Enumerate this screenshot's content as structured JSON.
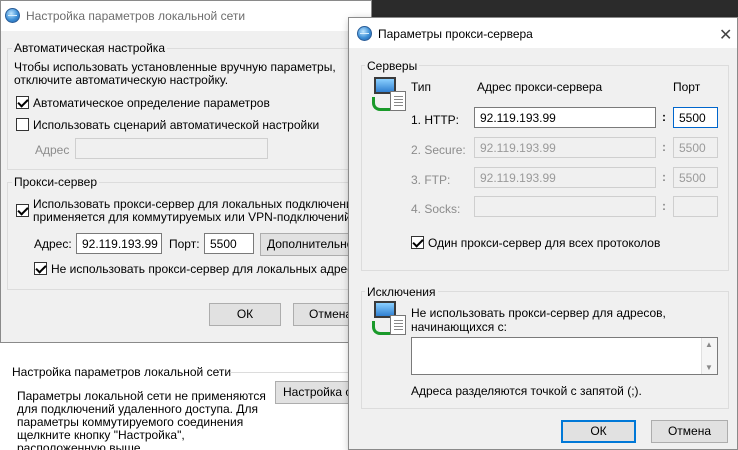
{
  "lan_window": {
    "title": "Настройка параметров локальной сети",
    "auto_group_label": "Автоматическая настройка",
    "auto_desc_1": "Чтобы использовать установленные вручную параметры,",
    "auto_desc_2": "отключите автоматическую настройку.",
    "auto_detect_label": "Автоматическое определение параметров",
    "auto_script_label": "Использовать сценарий автоматической настройки",
    "address_label": "Адрес",
    "proxy_group_label": "Прокси-сервер",
    "use_proxy_label_1": "Использовать прокси-сервер для локальных подключений (не",
    "use_proxy_label_2": "применяется для коммутируемых или VPN-подключений).",
    "proxy_address_label": "Адрес:",
    "proxy_address_value": "92.119.193.99",
    "port_label": "Порт:",
    "port_value": "5500",
    "advanced_button": "Дополнительно",
    "bypass_local_label": "Не использовать прокси-сервер для локальных адресов",
    "ok_button": "ОК",
    "cancel_button": "Отмена"
  },
  "background": {
    "section_title": "Настройка параметров локальной сети",
    "desc_lines": [
      "Параметры локальной сети не применяются",
      "для подключений удаленного доступа. Для",
      "параметры коммутируемого соединения",
      "щелкните кнопку \"Настройка\",",
      "расположенную выше."
    ],
    "settings_button": "Настройка се"
  },
  "proxy_window": {
    "title": "Параметры прокси-сервера",
    "close": "✕",
    "servers_group_label": "Серверы",
    "col_type": "Тип",
    "col_address": "Адрес прокси-сервера",
    "col_port": "Порт",
    "rows": [
      {
        "type": "1. HTTP:",
        "address": "92.119.193.99",
        "port": "5500"
      },
      {
        "type": "2. Secure:",
        "address": "92.119.193.99",
        "port": "5500"
      },
      {
        "type": "3. FTP:",
        "address": "92.119.193.99",
        "port": "5500"
      },
      {
        "type": "4. Socks:",
        "address": "",
        "port": ""
      }
    ],
    "colon": ":",
    "same_proxy_label": "Один прокси-сервер для всех протоколов",
    "exceptions_group_label": "Исключения",
    "exceptions_desc_1": "Не использовать прокси-сервер для адресов,",
    "exceptions_desc_2": "начинающихся с:",
    "exceptions_hint": "Адреса разделяются точкой с запятой (;).",
    "ok_button": "ОК",
    "cancel_button": "Отмена"
  },
  "colors": {
    "accent": "#0078d7",
    "dialog_bg": "#f0f0f0"
  }
}
